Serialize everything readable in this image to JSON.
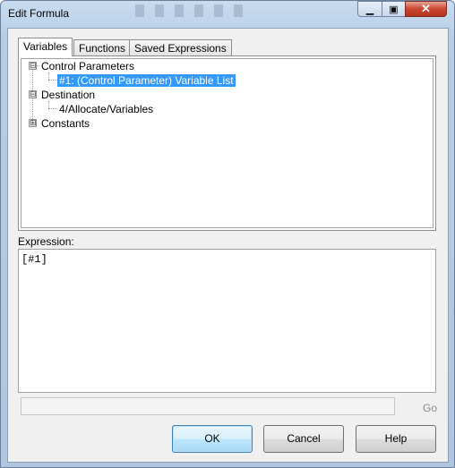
{
  "window": {
    "title": "Edit Formula"
  },
  "tabs": [
    {
      "label": "Variables",
      "active": true
    },
    {
      "label": "Functions",
      "active": false
    },
    {
      "label": "Saved Expressions",
      "active": false
    }
  ],
  "tree": {
    "nodes": [
      {
        "label": "Control Parameters",
        "expanded": true,
        "expander": "⊟"
      },
      {
        "label": "#1: (Control Parameter) Variable List",
        "selected": true
      },
      {
        "label": "Destination",
        "expanded": true,
        "expander": "⊟"
      },
      {
        "label": "4/Allocate/Variables"
      },
      {
        "label": "Constants",
        "expanded": false,
        "expander": "⊞"
      }
    ]
  },
  "expression": {
    "label": "Expression:",
    "value": "[#1]"
  },
  "go": {
    "label": "Go"
  },
  "buttons": {
    "ok": "OK",
    "cancel": "Cancel",
    "help": "Help"
  },
  "colors": {
    "selection": "#3399ff",
    "close_button": "#c9452f"
  }
}
